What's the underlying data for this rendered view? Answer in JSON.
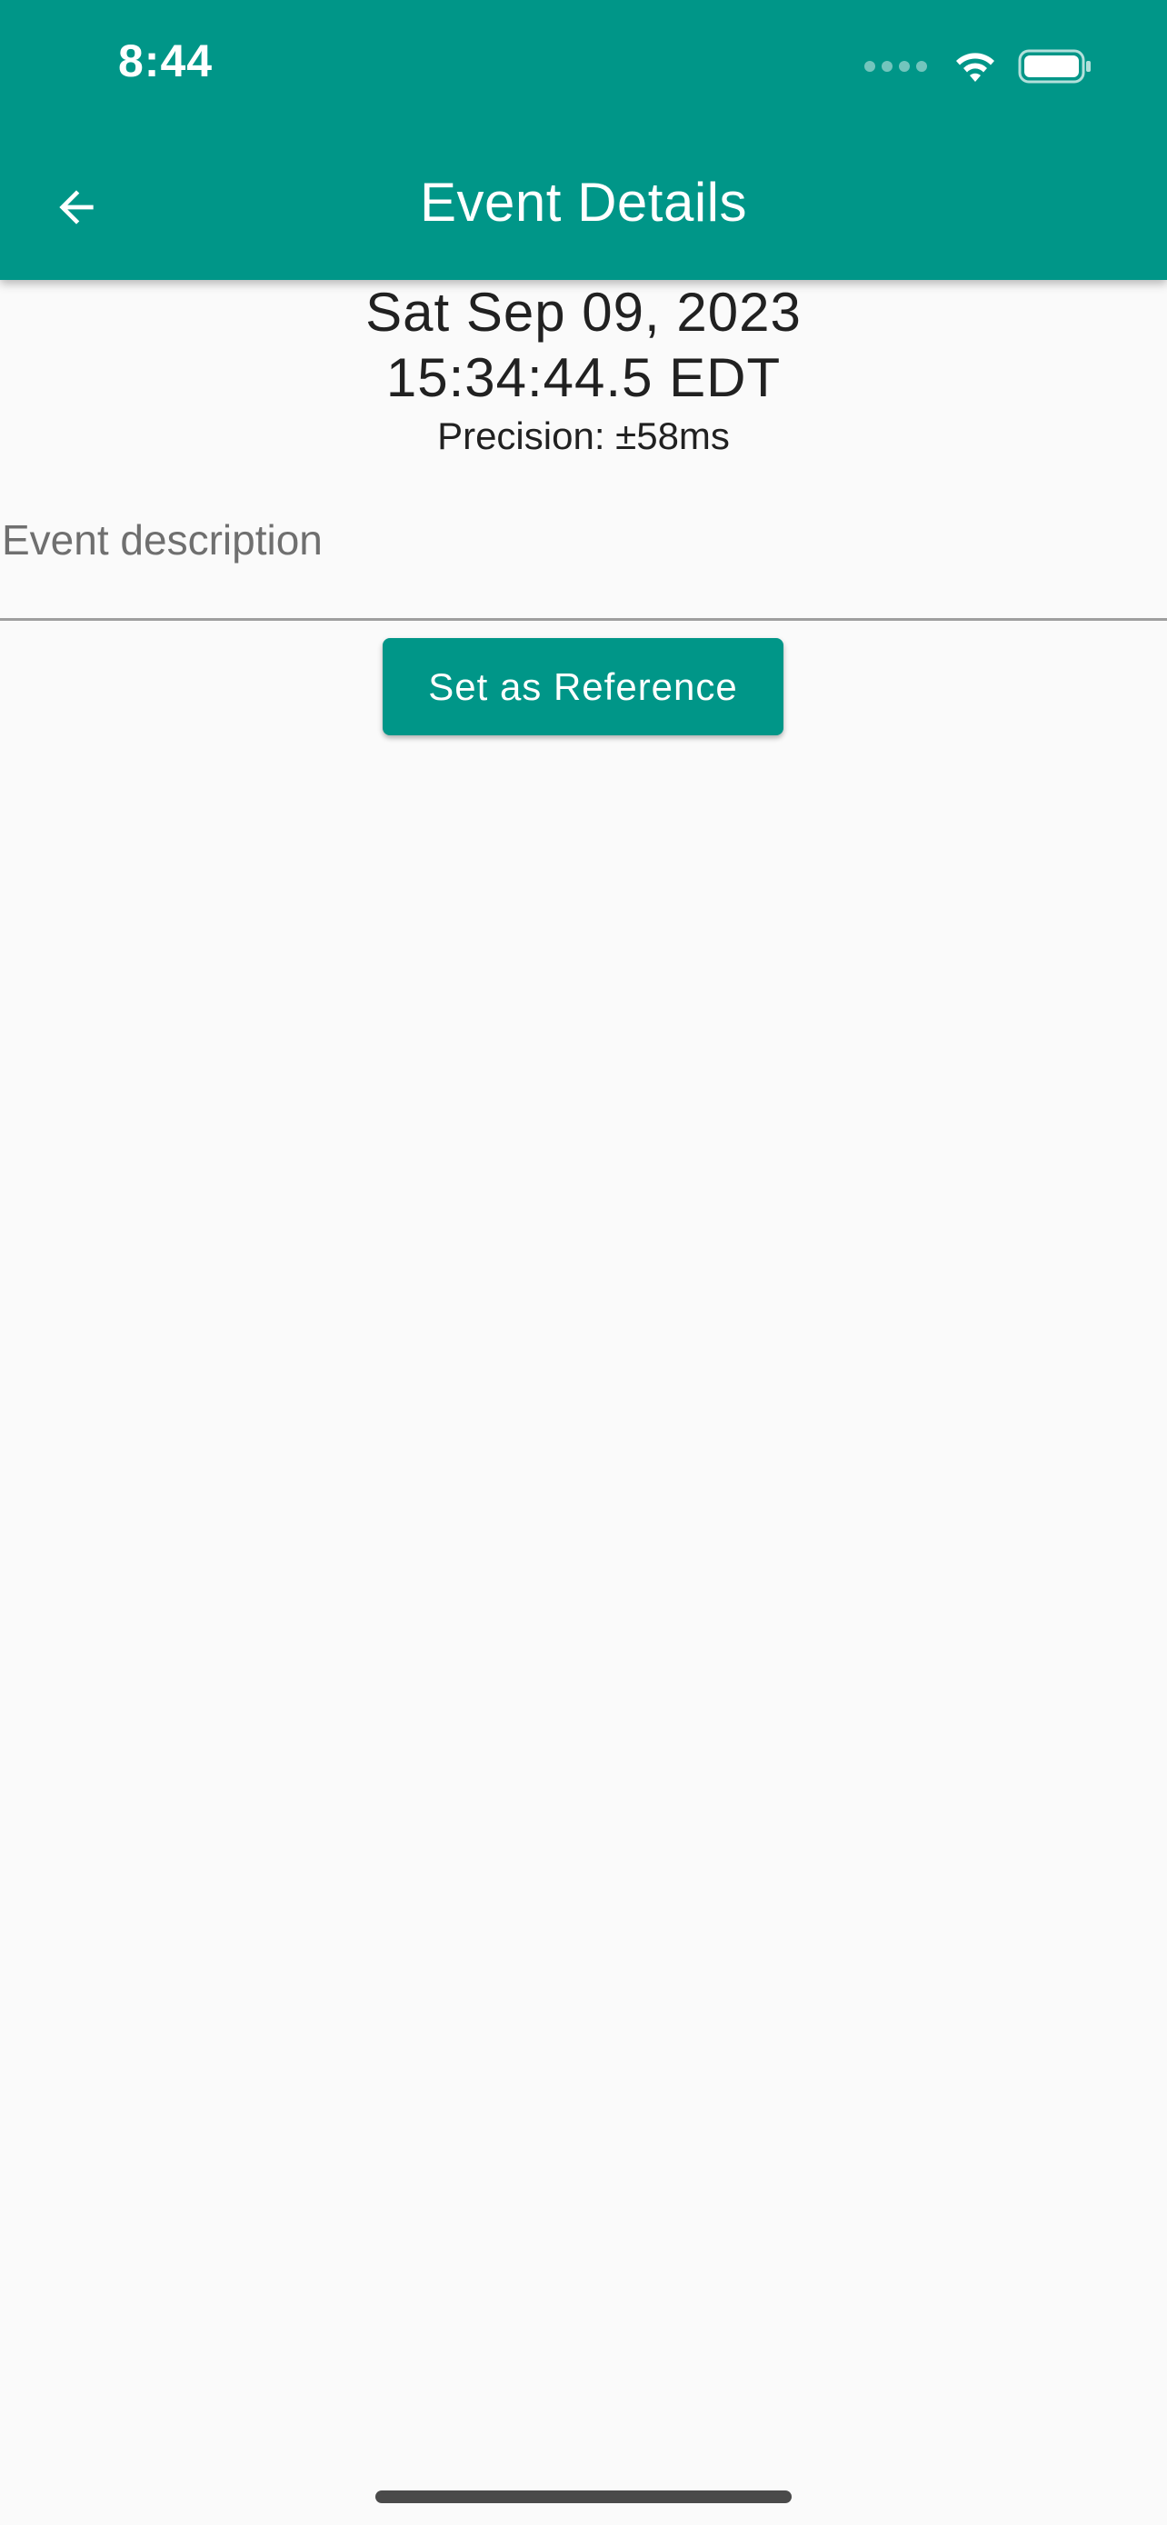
{
  "status_bar": {
    "time": "8:44",
    "icons": [
      "cellular-signal-icon",
      "wifi-icon",
      "battery-icon"
    ]
  },
  "app_bar": {
    "title": "Event Details",
    "back_icon": "arrow-back-icon",
    "color": "#009688"
  },
  "event": {
    "date": "Sat Sep 09, 2023",
    "time": "15:34:44.5 EDT",
    "precision": "Precision: ±58ms"
  },
  "description": {
    "value": "",
    "placeholder": "Event description"
  },
  "actions": {
    "set_reference_label": "Set as Reference"
  },
  "colors": {
    "accent": "#009688",
    "background": "#fafafa",
    "text": "#212121"
  }
}
